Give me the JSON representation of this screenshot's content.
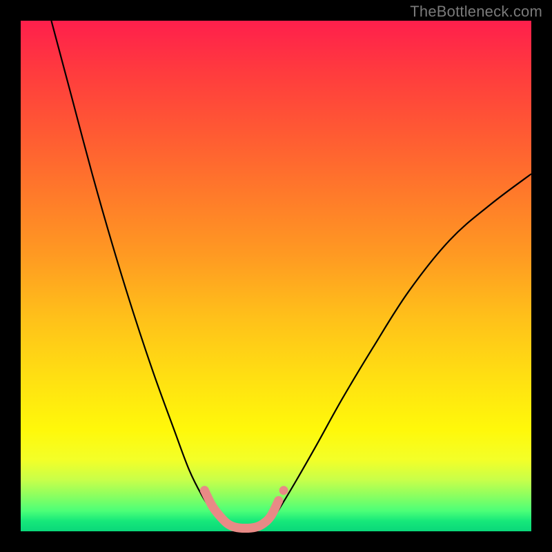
{
  "watermark": "TheBottleneck.com",
  "colors": {
    "background": "#000000",
    "gradient_top": "#ff1f4c",
    "gradient_bottom": "#0ad77a",
    "curve": "#000000",
    "marker": "#e88a86"
  },
  "chart_data": {
    "type": "line",
    "title": "",
    "xlabel": "",
    "ylabel": "",
    "xlim": [
      0,
      100
    ],
    "ylim": [
      0,
      100
    ],
    "grid": false,
    "legend": false,
    "series": [
      {
        "name": "left-curve",
        "x": [
          6,
          10,
          14,
          18,
          22,
          26,
          30,
          33,
          35.5,
          37.5,
          39,
          40.5,
          42
        ],
        "y": [
          100,
          85,
          70,
          56,
          43,
          31,
          20,
          12,
          7,
          4,
          2,
          1,
          0.5
        ]
      },
      {
        "name": "right-curve",
        "x": [
          47,
          49,
          51,
          54,
          58,
          63,
          69,
          76,
          84,
          92,
          100
        ],
        "y": [
          0.5,
          2,
          5,
          10,
          17,
          26,
          36,
          47,
          57,
          64,
          70
        ]
      },
      {
        "name": "marker-path",
        "x": [
          36,
          37.5,
          39,
          40.5,
          42,
          44,
          46,
          47.5,
          49,
          50.5
        ],
        "y": [
          8,
          5,
          3,
          1.5,
          0.8,
          0.6,
          0.8,
          1.5,
          3,
          6
        ]
      }
    ],
    "markers": [
      {
        "name": "isolated-dot",
        "x": 51.5,
        "y": 8
      }
    ]
  }
}
